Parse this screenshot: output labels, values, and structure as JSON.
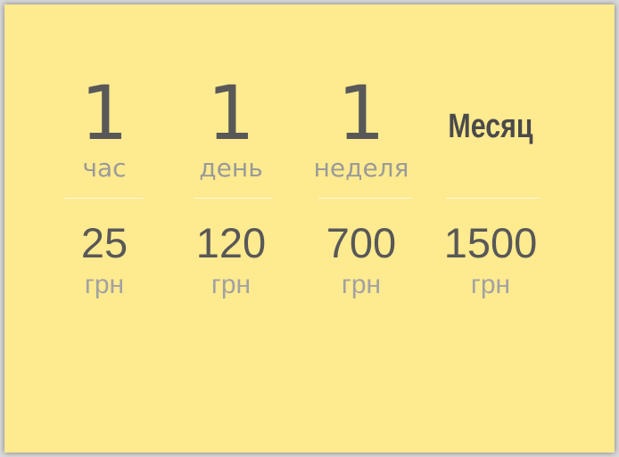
{
  "plans": [
    {
      "amount": "1",
      "period": "час",
      "price": "25",
      "currency": "грн"
    },
    {
      "amount": "1",
      "period": "день",
      "price": "120",
      "currency": "грн"
    },
    {
      "amount": "1",
      "period": "неделя",
      "price": "700",
      "currency": "грн"
    },
    {
      "period": "Месяц",
      "price": "1500",
      "currency": "грн"
    }
  ],
  "colors": {
    "background": "#feea8f",
    "text_dark": "#585858",
    "text_muted": "#9a9a9a",
    "divider": "#fff9e0"
  }
}
